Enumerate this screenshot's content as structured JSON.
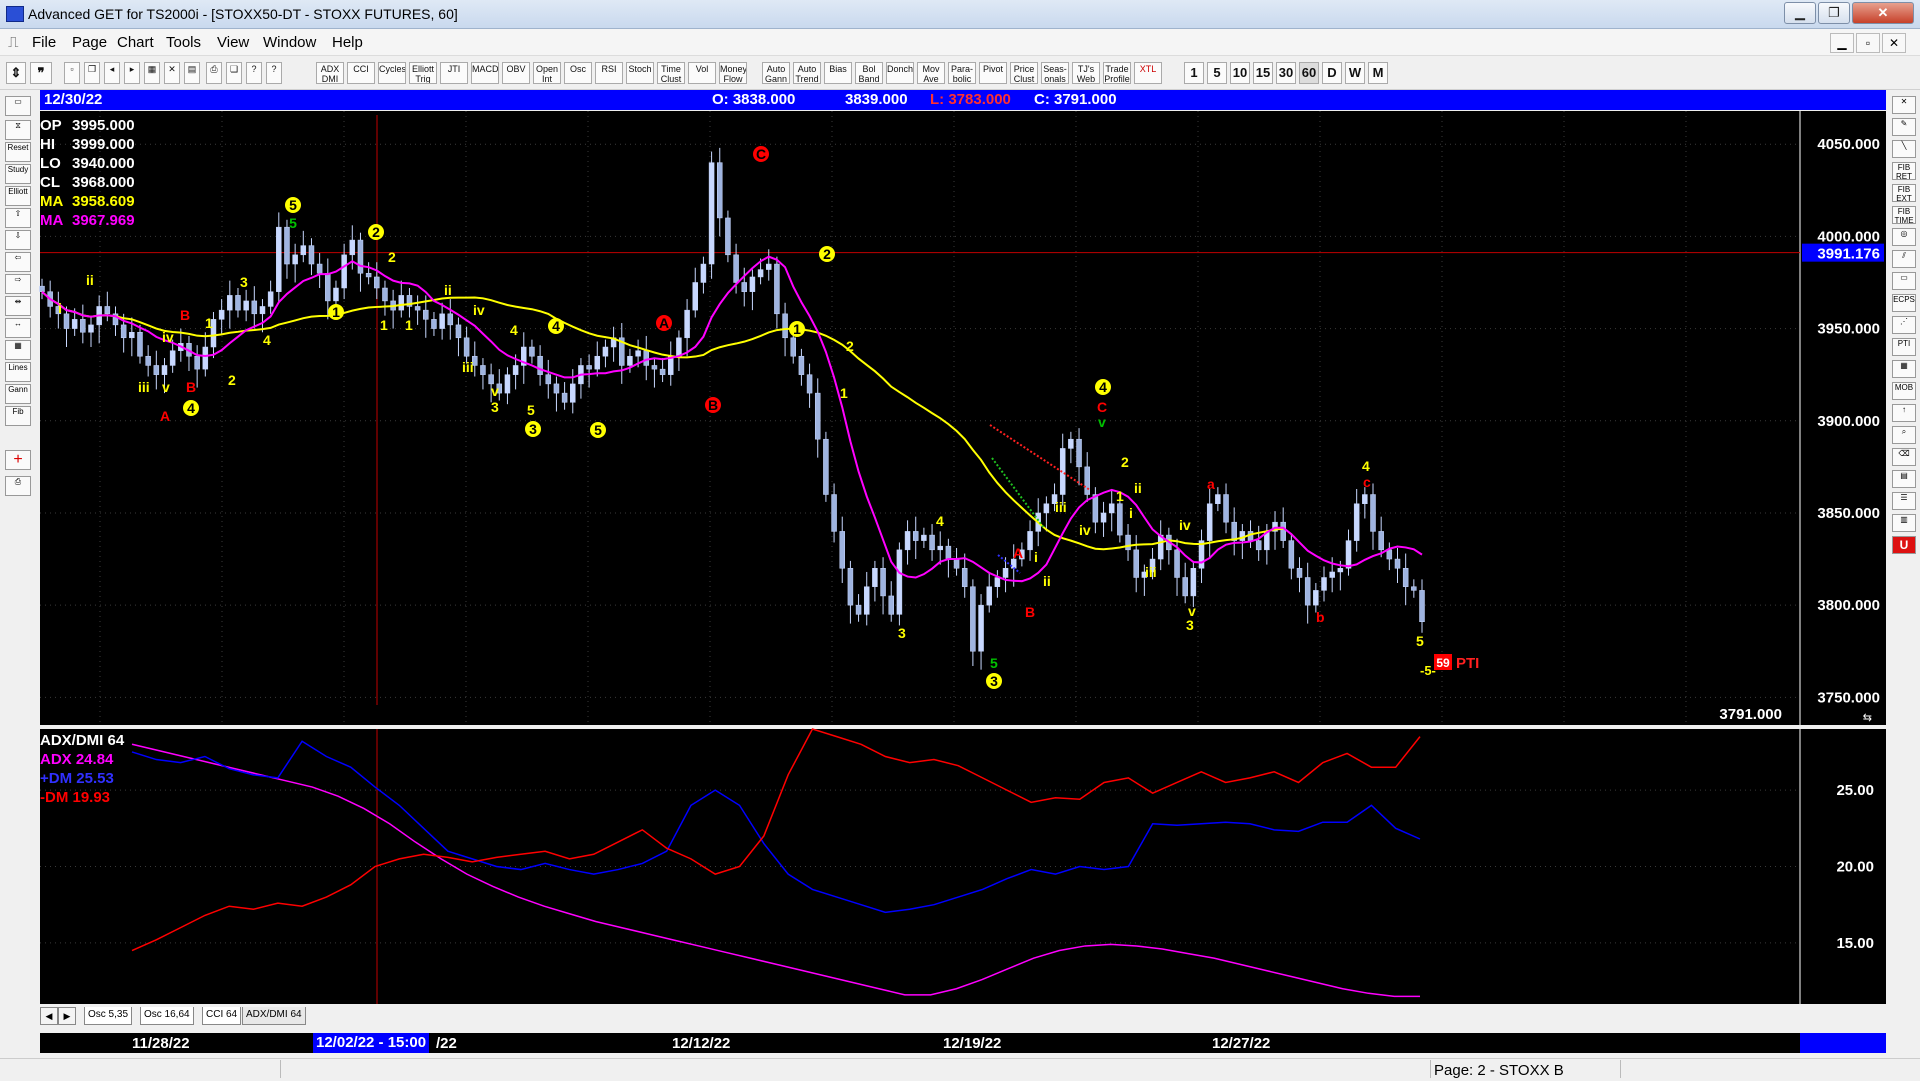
{
  "window": {
    "title": "Advanced GET for TS2000i - [STOXX50-DT - STOXX FUTURES, 60]",
    "minimize": "▁",
    "restore": "❐",
    "close": "✕"
  },
  "menu": {
    "items": [
      "File",
      "Page",
      "Chart",
      "Tools",
      "View",
      "Window",
      "Help"
    ],
    "mdi_buttons": [
      "▁",
      "▫",
      "✕"
    ]
  },
  "toolbar": {
    "buttons": [
      "ADX DMI",
      "CCI",
      "Cycles",
      "Elliott Trig",
      "JTI",
      "MACD",
      "OBV",
      "Open Int",
      "Osc",
      "RSI",
      "Stoch",
      "Time Clust",
      "Vol",
      "Money Flow",
      "Auto Gann",
      "Auto Trend",
      "Bias",
      "Bol Band",
      "Donch",
      "Mov Ave",
      "Para-bolic",
      "Pivot",
      "Price Clust",
      "Seas-onals",
      "TJ's Web",
      "Trade Profile",
      "XTL"
    ],
    "intervals": [
      "1",
      "5",
      "10",
      "15",
      "30",
      "60",
      "D",
      "W",
      "M"
    ],
    "active_interval": "60"
  },
  "left_tools": [
    "Reset",
    "Study",
    "Elliott",
    "Lines",
    "Gann",
    "Fib"
  ],
  "right_tools": [
    "FIB RET",
    "FIB EXT",
    "FIB TIME",
    "ECPS",
    "PTI",
    "MOB"
  ],
  "info_bar": {
    "date": "12/30/22",
    "open": "O: 3838.000",
    "high": "3839.000",
    "low": "L: 3783.000",
    "close": "C: 3791.000"
  },
  "legend": [
    {
      "label": "OP",
      "value": "3995.000",
      "color": "#ffffff"
    },
    {
      "label": "HI",
      "value": "3999.000",
      "color": "#ffffff"
    },
    {
      "label": "LO",
      "value": "3940.000",
      "color": "#ffffff"
    },
    {
      "label": "CL",
      "value": "3968.000",
      "color": "#ffffff"
    },
    {
      "label": "MA",
      "value": "3958.609",
      "color": "#ffff00"
    },
    {
      "label": "MA",
      "value": "3967.969",
      "color": "#ff00ff"
    }
  ],
  "price_tag": "3991.176",
  "last_price": "3791.000",
  "pti": {
    "value": "59",
    "label": "PTI",
    "target": "-5-"
  },
  "lower_legend": {
    "title": "ADX/DMI 64",
    "adx": "ADX 24.84",
    "plus_dm": "+DM 25.53",
    "minus_dm": "-DM  19.93"
  },
  "tabs": [
    "Osc 5,35",
    "Osc 16,64",
    "CCI 64",
    "ADX/DMI 64"
  ],
  "active_tab": "ADX/DMI 64",
  "dates": {
    "ticks": [
      "11/28/22",
      "/22",
      "12/12/22",
      "12/19/22",
      "12/27/22"
    ],
    "cursor": "12/02/22 - 15:00"
  },
  "status": "Page: 2 - STOXX B",
  "chart_data": [
    {
      "type": "candlestick",
      "title": "STOXX50-DT - STOXX FUTURES, 60",
      "ylim": [
        3735,
        4068
      ],
      "y_ticks": [
        3750,
        3800,
        3850,
        3900,
        3950,
        4000,
        4050
      ],
      "y_tick_labels": [
        "3750.000",
        "3800.000",
        "3850.000",
        "3900.000",
        "3950.000",
        "4000.000",
        "4050.000"
      ],
      "hline": 3991.176,
      "closes": [
        3970,
        3962,
        3958,
        3950,
        3955,
        3948,
        3952,
        3962,
        3958,
        3952,
        3945,
        3948,
        3935,
        3930,
        3925,
        3930,
        3938,
        3942,
        3935,
        3928,
        3940,
        3955,
        3960,
        3968,
        3960,
        3965,
        3958,
        3962,
        3970,
        4005,
        3985,
        3990,
        3995,
        3985,
        3980,
        3965,
        3972,
        3990,
        3998,
        3980,
        3978,
        3972,
        3965,
        3960,
        3968,
        3962,
        3960,
        3955,
        3950,
        3958,
        3952,
        3945,
        3935,
        3930,
        3925,
        3920,
        3915,
        3925,
        3930,
        3940,
        3935,
        3925,
        3920,
        3915,
        3910,
        3920,
        3930,
        3928,
        3935,
        3940,
        3945,
        3930,
        3935,
        3938,
        3930,
        3928,
        3925,
        3935,
        3945,
        3960,
        3975,
        3985,
        4040,
        4010,
        3990,
        3975,
        3970,
        3978,
        3982,
        3985,
        3958,
        3945,
        3935,
        3925,
        3915,
        3890,
        3860,
        3840,
        3820,
        3800,
        3795,
        3810,
        3820,
        3805,
        3795,
        3830,
        3840,
        3835,
        3838,
        3830,
        3832,
        3825,
        3820,
        3810,
        3775,
        3800,
        3810,
        3815,
        3820,
        3825,
        3830,
        3840,
        3850,
        3855,
        3860,
        3885,
        3890,
        3875,
        3860,
        3845,
        3850,
        3855,
        3838,
        3830,
        3815,
        3818,
        3825,
        3838,
        3830,
        3815,
        3805,
        3820,
        3835,
        3855,
        3860,
        3845,
        3835,
        3840,
        3835,
        3830,
        3840,
        3845,
        3835,
        3820,
        3815,
        3800,
        3808,
        3815,
        3818,
        3820,
        3835,
        3855,
        3860,
        3840,
        3830,
        3825,
        3820,
        3810,
        3808,
        3791
      ],
      "ma_short_color": "#ffff00",
      "ma_long_color": "#ff00ff",
      "last": 3791.0
    },
    {
      "type": "line",
      "title": "ADX/DMI 64",
      "ylim": [
        11,
        29
      ],
      "y_ticks": [
        15,
        20,
        25
      ],
      "y_tick_labels": [
        "15.00",
        "20.00",
        "25.00"
      ],
      "series": [
        {
          "name": "ADX",
          "color": "#ff00ff",
          "values": [
            28,
            27.6,
            27.2,
            26.8,
            26.4,
            26,
            25.6,
            25.2,
            24.6,
            23.8,
            22.8,
            21.6,
            20.5,
            19.5,
            18.7,
            18,
            17.4,
            16.9,
            16.4,
            16,
            15.6,
            15.2,
            14.8,
            14.4,
            14,
            13.6,
            13.2,
            12.8,
            12.4,
            12,
            11.6,
            11.6,
            12,
            12.6,
            13.3,
            14,
            14.5,
            14.8,
            14.9,
            14.8,
            14.6,
            14.3,
            14,
            13.6,
            13.2,
            12.8,
            12.4,
            12,
            11.7,
            11.5,
            11.5
          ]
        },
        {
          "name": "+DM",
          "color": "#0000ff",
          "values": [
            27.5,
            27,
            26.8,
            27.2,
            26.4,
            26,
            25.8,
            28.2,
            27.2,
            26.5,
            25.2,
            24,
            22.5,
            21,
            20.5,
            20,
            19.8,
            20.2,
            19.8,
            19.5,
            19.8,
            20.2,
            21,
            24,
            25,
            24,
            21.5,
            19.5,
            18.5,
            18,
            17.5,
            17,
            17.2,
            17.5,
            18,
            18.5,
            19.2,
            19.8,
            19.5,
            20,
            19.8,
            20,
            22.8,
            22.7,
            22.8,
            22.9,
            22.8,
            22.4,
            22.3,
            22.9,
            22.9,
            24,
            22.5,
            21.8
          ]
        },
        {
          "name": "-DM",
          "color": "#ff0000",
          "values": [
            14.5,
            15.2,
            16,
            16.8,
            17.4,
            17.2,
            17.6,
            17.4,
            18,
            18.8,
            20,
            20.5,
            20.8,
            20.6,
            20.3,
            20.6,
            20.8,
            21,
            20.5,
            20.8,
            21.6,
            22.4,
            21.2,
            20.5,
            19.5,
            20,
            22,
            26,
            29,
            28.5,
            28,
            27.2,
            26.8,
            27,
            26.6,
            25.8,
            25,
            24.2,
            24.5,
            24.4,
            25.5,
            25.8,
            24.8,
            25.5,
            26.2,
            25.5,
            25.8,
            26.2,
            25.5,
            26.8,
            27.4,
            26.5,
            26.5,
            28.5
          ]
        }
      ]
    }
  ]
}
